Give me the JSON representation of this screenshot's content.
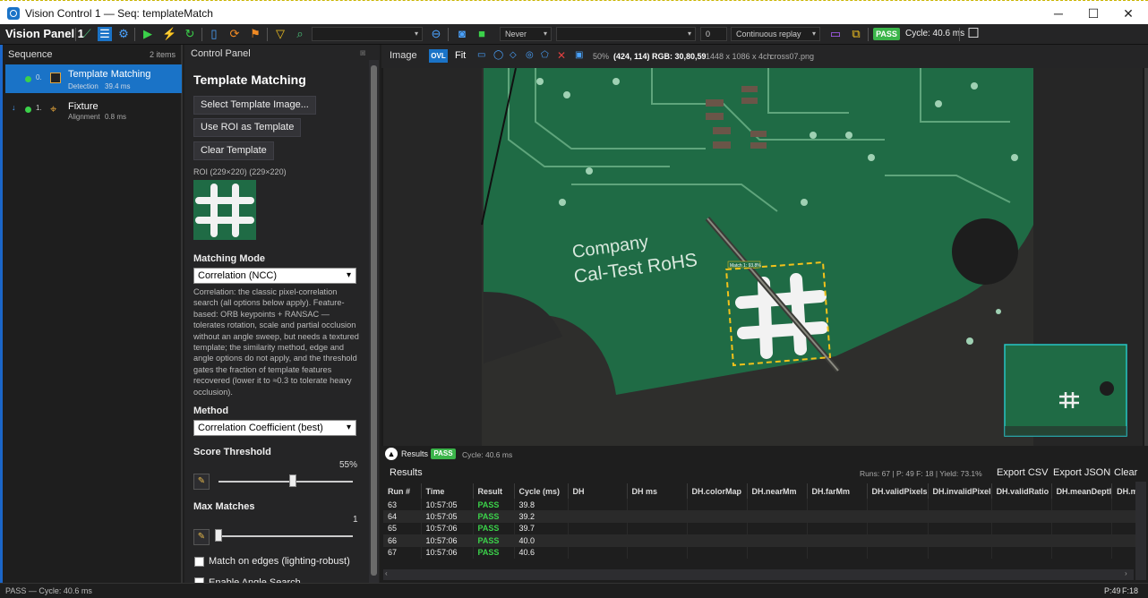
{
  "window": {
    "title": "Vision Control 1 — Seq: templateMatch"
  },
  "toolbar": {
    "panel_title": "Vision Panel 1",
    "trigger_mode": "Never",
    "frame_value": "0",
    "replay_mode": "Continuous replay",
    "pass_badge": "PASS",
    "cycle_text": "Cycle: 40.6 ms"
  },
  "sequence": {
    "header": "Sequence",
    "count": "2 items",
    "items": [
      {
        "index": "0.",
        "name": "Template Matching",
        "type": "Detection",
        "time": "39.4 ms"
      },
      {
        "index": "1.",
        "name": "Fixture",
        "type": "Alignment",
        "time": "0.8 ms"
      }
    ]
  },
  "control_panel": {
    "header": "Control Panel",
    "title": "Template Matching",
    "btn_select": "Select Template Image...",
    "btn_roi": "Use ROI as Template",
    "btn_clear": "Clear Template",
    "roi_label": "ROI (229×220) (229×220)",
    "matching_mode_label": "Matching Mode",
    "matching_mode_value": "Correlation (NCC)",
    "matching_mode_desc": "Correlation: the classic pixel-correlation search (all options below apply). Feature-based: ORB keypoints + RANSAC — tolerates rotation, scale and partial occlusion without an angle sweep, but needs a textured template; the similarity method, edge and angle options do not apply, and the threshold gates the fraction of template features recovered (lower it to ≈0.3 to tolerate heavy occlusion).",
    "method_label": "Method",
    "method_value": "Correlation Coefficient (best)",
    "score_label": "Score Threshold",
    "score_value": "55%",
    "score_fraction": 0.55,
    "max_label": "Max Matches",
    "max_value": "1",
    "edges_label": "Match on edges (lighting-robust)",
    "angle_label": "Enable Angle Search"
  },
  "image_panel": {
    "header": "Image",
    "ovl": "OVL",
    "fit": "Fit",
    "zoom": "50%",
    "coords": "(424, 114)",
    "rgb": "RGB: 30,80,59",
    "dims": "1448 x 1086 x 4ch",
    "file": "cross07.png",
    "board_text_1": "Company",
    "board_text_2": "Cal-Test RoHS",
    "match_label": "Match 1: 93.8%"
  },
  "results": {
    "bar_label": "Results",
    "bar_badge": "PASS",
    "bar_cycle": "Cycle: 40.6 ms",
    "title": "Results",
    "stats": "Runs: 67  |  P: 49  F: 18  |  Yield: 73.1%",
    "export_csv": "Export CSV",
    "export_json": "Export JSON",
    "clear": "Clear",
    "columns": [
      "Run #",
      "Time",
      "Result",
      "Cycle (ms)",
      "DH",
      "DH ms",
      "DH.colorMap",
      "DH.nearMm",
      "DH.farMm",
      "DH.validPixels",
      "DH.invalidPixel",
      "DH.validRatio",
      "DH.meanDeptl",
      "DH.m"
    ],
    "rows": [
      [
        "63",
        "10:57:05",
        "PASS",
        "39.8"
      ],
      [
        "64",
        "10:57:05",
        "PASS",
        "39.2"
      ],
      [
        "65",
        "10:57:06",
        "PASS",
        "39.7"
      ],
      [
        "66",
        "10:57:06",
        "PASS",
        "40.0"
      ],
      [
        "67",
        "10:57:06",
        "PASS",
        "40.6"
      ]
    ]
  },
  "status": {
    "left": "PASS — Cycle: 40.6 ms",
    "right_p": "P:49",
    "right_f": "F:18"
  },
  "colors": {
    "accent": "#1a73c7",
    "pass": "#3bb54a",
    "pcb": "#1f6b45"
  }
}
